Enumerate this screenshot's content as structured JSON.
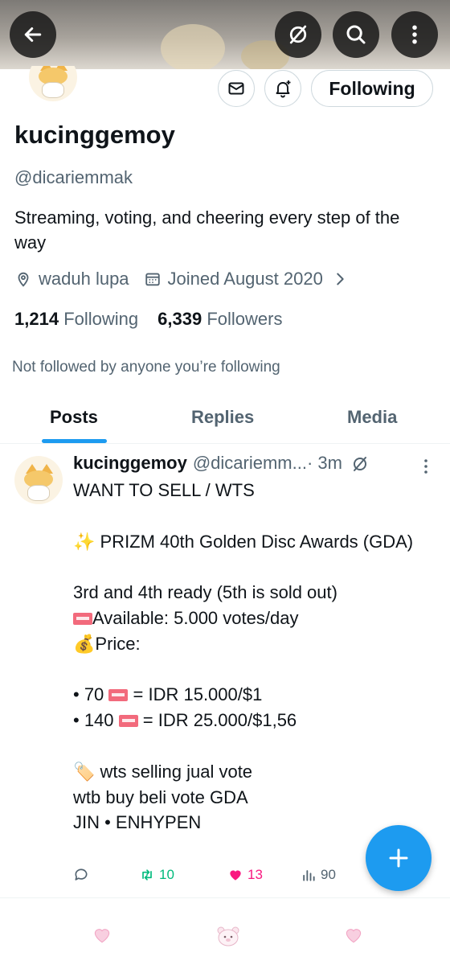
{
  "header": {
    "back_icon": "arrow-left-icon",
    "grok_icon": "slashed-circle-icon",
    "search_icon": "search-icon",
    "more_icon": "vertical-dots-icon"
  },
  "profile": {
    "display_name": "kucinggemoy",
    "handle": "@dicariemmak",
    "bio": "Streaming, voting, and cheering every step of the way",
    "location": "waduh lupa",
    "joined": "Joined August 2020",
    "following_count": "1,214",
    "following_label": "Following",
    "followers_count": "6,339",
    "followers_label": "Followers",
    "not_followed_text": "Not followed by anyone you’re following",
    "follow_button_label": "Following"
  },
  "tabs": [
    {
      "label": "Posts",
      "active": true
    },
    {
      "label": "Replies",
      "active": false
    },
    {
      "label": "Media",
      "active": false
    }
  ],
  "post": {
    "author_name": "kucinggemoy",
    "author_handle": "@dicariemm...",
    "time": " · 3m",
    "lines": {
      "l1": "WANT TO SELL / WTS",
      "l2": "✨ PRIZM 40th Golden Disc Awards (GDA)",
      "l3": "3rd and 4th ready (5th is sold out)",
      "l4": "Available: 5.000 votes/day",
      "l5": "💰Price:",
      "l6a": "• 70 ",
      "l6b": " = IDR 15.000/$1",
      "l7a": "• 140 ",
      "l7b": " = IDR 25.000/$1,56",
      "l8": "🏷️ wts selling jual vote",
      "l9": "wtb buy beli vote GDA",
      "l10": "JIN • ENHYPEN"
    },
    "retweets": "10",
    "likes": "13",
    "views": "90"
  },
  "colors": {
    "accent": "#1d9bf0",
    "text_primary": "#0f1419",
    "text_secondary": "#536471",
    "retweet": "#00ba7c",
    "like": "#f91880"
  }
}
